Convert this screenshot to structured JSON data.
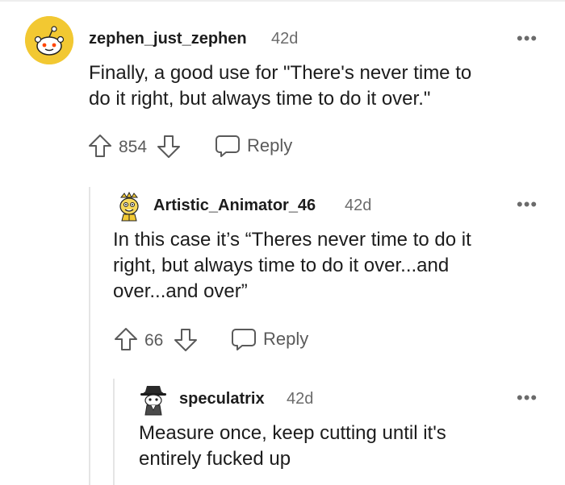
{
  "comments": [
    {
      "username": "zephen_just_zephen",
      "time": "42d",
      "body_lines": [
        "Finally, a good use for \"There's never time to",
        "do it right, but always time to do it over.\""
      ],
      "score": "854",
      "reply_label": "Reply",
      "avatar": "snoo-default-yellow-icon"
    },
    {
      "username": "Artistic_Animator_46",
      "time": "42d",
      "body_lines": [
        "In this case it’s “Theres never time to do it",
        "right, but always time to do it over...and",
        "over...and over”"
      ],
      "score": "66",
      "reply_label": "Reply",
      "avatar": "yellow-character-icon"
    },
    {
      "username": "speculatrix",
      "time": "42d",
      "body_lines": [
        "Measure once, keep cutting until it's",
        "entirely fucked up"
      ],
      "avatar": "hat-character-icon"
    }
  ],
  "more_label": "•••",
  "colors": {
    "avatar_yellow": "#f2c832",
    "meta_gray": "#6b6b6b",
    "thread_line": "#e5e5e5"
  }
}
